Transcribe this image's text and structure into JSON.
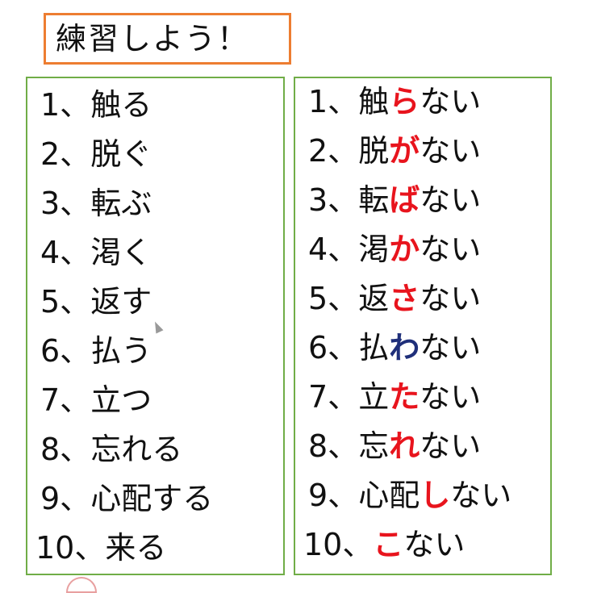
{
  "title": "練習しよう！",
  "left_items": [
    {
      "num": "1、",
      "word": "触る"
    },
    {
      "num": "2、",
      "word": "脱ぐ"
    },
    {
      "num": "3、",
      "word": "転ぶ"
    },
    {
      "num": "4、",
      "word": "渇く"
    },
    {
      "num": "5、",
      "word": "返す"
    },
    {
      "num": "6、",
      "word": "払う"
    },
    {
      "num": "7、",
      "word": "立つ"
    },
    {
      "num": "8、",
      "word": "忘れる"
    },
    {
      "num": "9、",
      "word": "心配する"
    },
    {
      "num": "10、",
      "word": "来る"
    }
  ],
  "right_items": [
    {
      "num": "1、",
      "stem": "触",
      "hl": "ら",
      "tail": "ない",
      "color": "red"
    },
    {
      "num": "2、",
      "stem": "脱",
      "hl": "が",
      "tail": "ない",
      "color": "red"
    },
    {
      "num": "3、",
      "stem": "転",
      "hl": "ば",
      "tail": "ない",
      "color": "red"
    },
    {
      "num": "4、",
      "stem": "渇",
      "hl": "か",
      "tail": "ない",
      "color": "red"
    },
    {
      "num": "5、",
      "stem": "返",
      "hl": "さ",
      "tail": "ない",
      "color": "red"
    },
    {
      "num": "6、",
      "stem": "払",
      "hl": "わ",
      "tail": "ない",
      "color": "blue"
    },
    {
      "num": "7、",
      "stem": "立",
      "hl": "た",
      "tail": "ない",
      "color": "red"
    },
    {
      "num": "8、",
      "stem": "忘",
      "hl": "れ",
      "tail": "ない",
      "color": "red"
    },
    {
      "num": "9、",
      "stem": "心配",
      "hl": "し",
      "tail": "ない",
      "color": "red"
    },
    {
      "num": "10、",
      "stem": "",
      "hl": "こ",
      "tail": "ない",
      "color": "red"
    }
  ],
  "colors": {
    "title_border": "#ed7d31",
    "panel_border": "#70ad47",
    "highlight_red": "#e8141d",
    "highlight_blue": "#1f2f7a"
  }
}
